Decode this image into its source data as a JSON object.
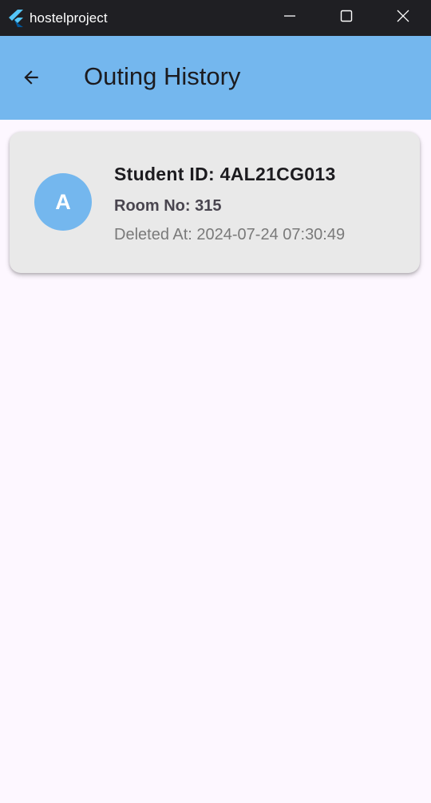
{
  "window": {
    "title": "hostelproject",
    "controls": [
      "minimize-icon",
      "maximize-icon",
      "close-icon"
    ]
  },
  "appbar": {
    "title": "Outing History",
    "back_icon": "arrow-back-icon",
    "background": "#74b7ee"
  },
  "history": [
    {
      "avatar_letter": "A",
      "student_id": "Student ID: 4AL21CG013",
      "room_no": "Room No: 315",
      "deleted_at": "Deleted At: 2024-07-24 07:30:49"
    }
  ],
  "colors": {
    "accent": "#74b7ee",
    "page_background": "#fdf7ff",
    "card_background": "#e9e9e9",
    "titlebar": "#1f1f23"
  }
}
